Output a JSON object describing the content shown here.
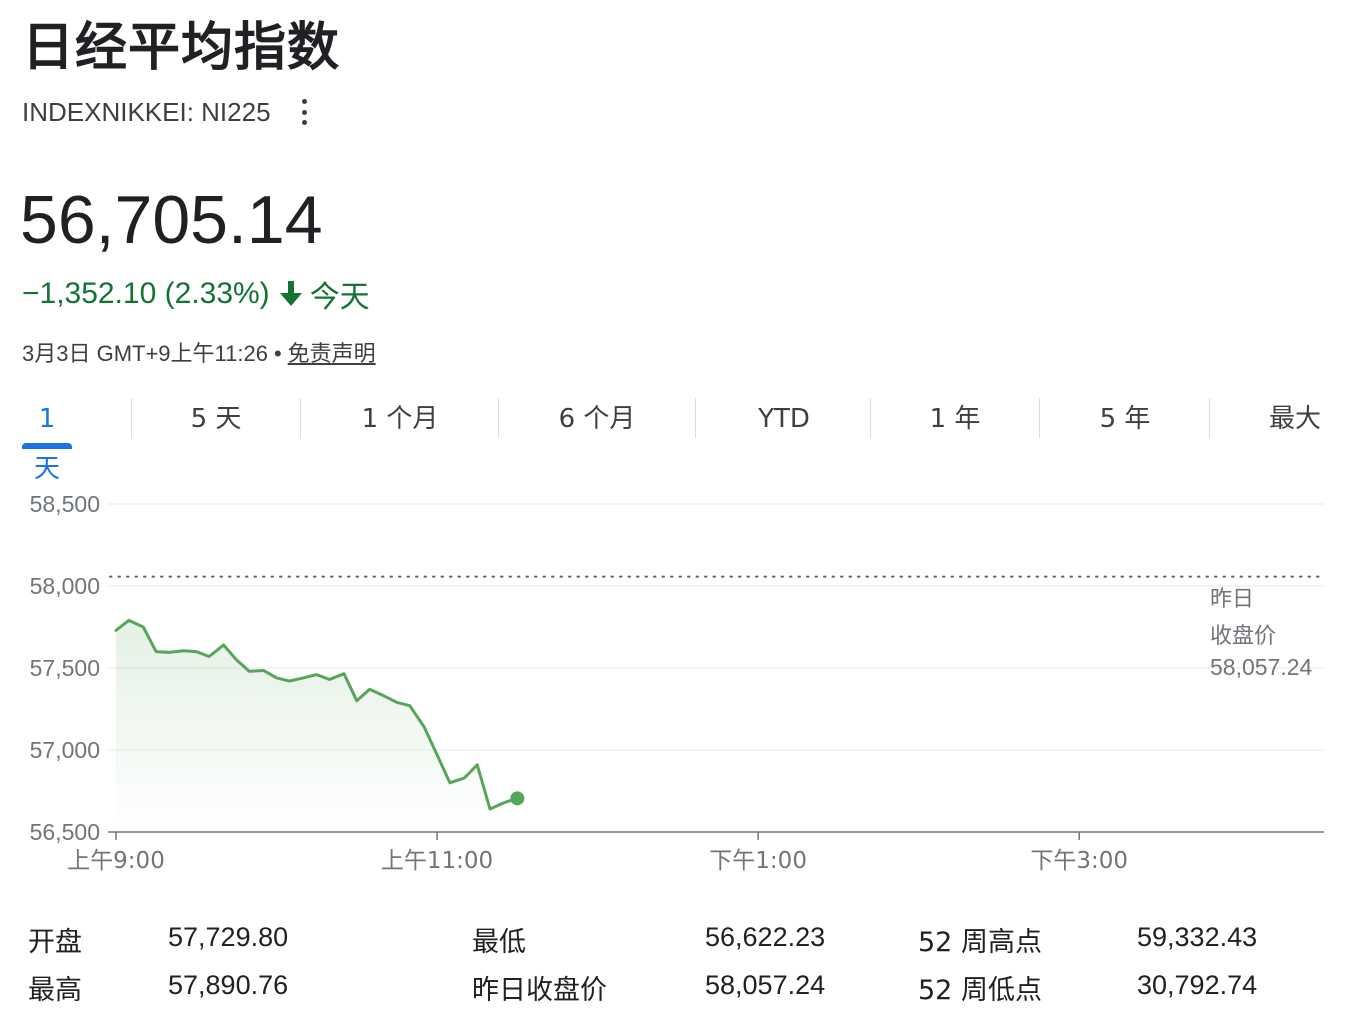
{
  "header": {
    "title": "日经平均指数",
    "ticker": "INDEXNIKKEI: NI225"
  },
  "quote": {
    "price": "56,705.14",
    "change": "−1,352.10 (2.33%)",
    "period": "今天",
    "timestamp": "3月3日 GMT+9上午11:26",
    "separator": "•",
    "disclaimer": "免责声明",
    "change_color": "#137333"
  },
  "tabs": [
    {
      "label": "1 天",
      "active": true
    },
    {
      "label": "5 天"
    },
    {
      "label": "1 个月"
    },
    {
      "label": "6 个月"
    },
    {
      "label": "YTD"
    },
    {
      "label": "1 年"
    },
    {
      "label": "5 年"
    },
    {
      "label": "最大"
    }
  ],
  "chart_data": {
    "type": "area",
    "y_ticks": [
      "58,500",
      "58,000",
      "57,500",
      "57,000",
      "56,500"
    ],
    "ylim": [
      56500,
      58500
    ],
    "x_ticks": [
      "上午9:00",
      "上午11:00",
      "下午1:00",
      "下午3:00"
    ],
    "x_unit": "hours after 9:00",
    "xlim": [
      0,
      7.5
    ],
    "grid": true,
    "line_color": "#57a55a",
    "reference": {
      "label_line1": "昨日",
      "label_line2": "收盘价",
      "value_label": "58,057.24",
      "value": 58057.24
    },
    "series": [
      {
        "x": [
          0,
          0.08,
          0.17,
          0.25,
          0.33,
          0.42,
          0.5,
          0.58,
          0.67,
          0.75,
          0.83,
          0.92,
          1.0,
          1.08,
          1.17,
          1.25,
          1.33,
          1.42,
          1.5,
          1.58,
          1.67,
          1.75,
          1.83,
          1.92,
          2.0,
          2.08,
          2.17,
          2.25,
          2.33,
          2.42,
          2.5,
          2.58,
          2.65
        ],
        "y": [
          57729.8,
          57790,
          57750,
          57600,
          57595,
          57605,
          57600,
          57570,
          57640,
          57550,
          57480,
          57485,
          57440,
          57420,
          57440,
          57460,
          57430,
          57465,
          57300,
          57370,
          57330,
          57290,
          57270,
          57140,
          56970,
          56800,
          56830,
          56910,
          56640,
          56680,
          56705.14,
          null,
          null
        ]
      }
    ]
  },
  "stats": [
    {
      "label": "开盘",
      "value": "57,729.80"
    },
    {
      "label": "最高",
      "value": "57,890.76"
    },
    {
      "label": "最低",
      "value": "56,622.23"
    },
    {
      "label": "昨日收盘价",
      "value": "58,057.24"
    },
    {
      "label": "52 周高点",
      "value": "59,332.43"
    },
    {
      "label": "52 周低点",
      "value": "30,792.74"
    }
  ]
}
